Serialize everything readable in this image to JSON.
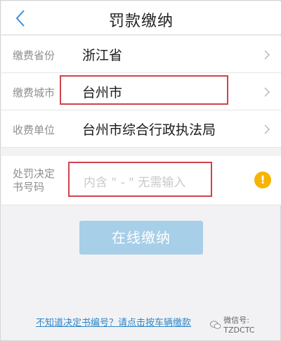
{
  "navbar": {
    "title": "罚款缴纳",
    "back_icon": "chevron-left-icon"
  },
  "form": {
    "rows": [
      {
        "label": "缴费省份",
        "value": "浙江省"
      },
      {
        "label": "缴费城市",
        "value": "台州市"
      },
      {
        "label": "收费单位",
        "value": "台州市综合行政执法局"
      }
    ],
    "decision_label": "处罚决定书号码",
    "decision_placeholder": "内含 \" - \" 无需输入"
  },
  "actions": {
    "pay_label": "在线缴纳"
  },
  "footer": {
    "help_link": "不知道决定书编号？请点击按车辆缴款",
    "watermark": "微信号: TZDCTC"
  },
  "colors": {
    "accent": "#2f86c9",
    "button": "#a7cfe8",
    "highlight": "#d2424c",
    "warning": "#f5b400"
  }
}
